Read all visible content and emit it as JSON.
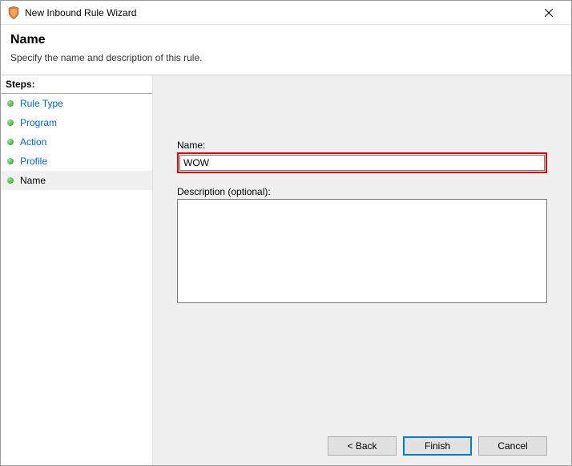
{
  "window": {
    "title": "New Inbound Rule Wizard"
  },
  "header": {
    "title": "Name",
    "description": "Specify the name and description of this rule."
  },
  "sidebar": {
    "steps_header": "Steps:",
    "items": [
      {
        "label": "Rule Type"
      },
      {
        "label": "Program"
      },
      {
        "label": "Action"
      },
      {
        "label": "Profile"
      },
      {
        "label": "Name"
      }
    ]
  },
  "form": {
    "name_label": "Name:",
    "name_value": "WOW",
    "desc_label": "Description (optional):",
    "desc_value": ""
  },
  "buttons": {
    "back": "< Back",
    "finish": "Finish",
    "cancel": "Cancel"
  }
}
